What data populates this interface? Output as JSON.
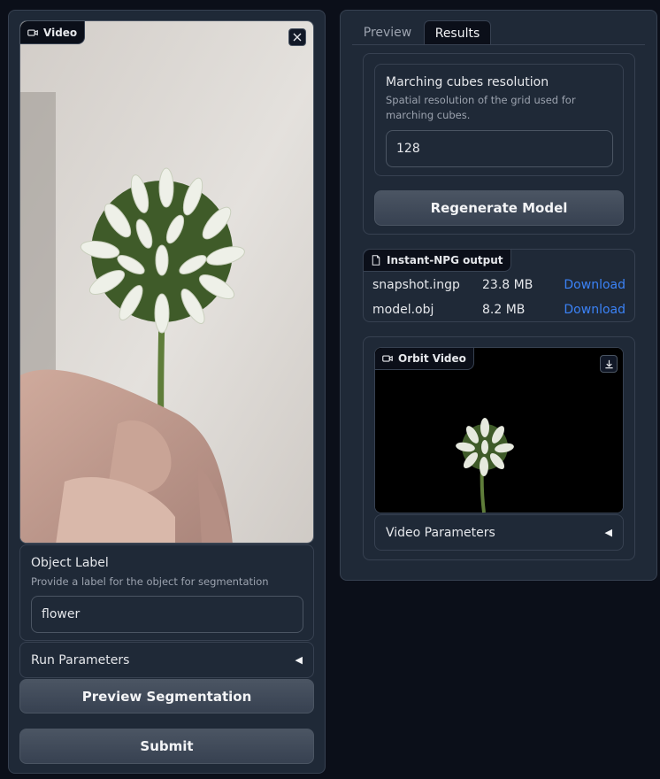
{
  "left": {
    "video_label": "Video",
    "object_label": {
      "title": "Object Label",
      "info": "Provide a label for the object for segmentation",
      "value": "flower"
    },
    "run_parameters_label": "Run Parameters",
    "preview_button": "Preview Segmentation",
    "submit_button": "Submit"
  },
  "right": {
    "tabs": [
      {
        "label": "Preview",
        "selected": false
      },
      {
        "label": "Results",
        "selected": true
      }
    ],
    "marching": {
      "title": "Marching cubes resolution",
      "info": "Spatial resolution of the grid used for marching cubes.",
      "value": "128"
    },
    "regenerate_button": "Regenerate Model",
    "files": {
      "label": "Instant-NPG output",
      "rows": [
        {
          "name": "snapshot.ingp",
          "size": "23.8 MB",
          "action": "Download"
        },
        {
          "name": "model.obj",
          "size": "8.2 MB",
          "action": "Download"
        }
      ]
    },
    "orbit_video_label": "Orbit Video",
    "video_parameters_label": "Video Parameters"
  },
  "colors": {
    "background": "#0b0f19",
    "panel": "#1f2937",
    "border": "#374151",
    "link": "#3b82f6"
  }
}
